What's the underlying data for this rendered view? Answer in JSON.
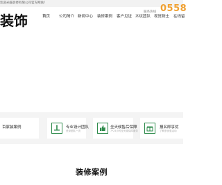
{
  "topbar": {
    "welcome": "欢迎光临装修有限公司官方网站！"
  },
  "header": {
    "logo": "装饰",
    "hotline_label": "服务热线",
    "phone": "0558"
  },
  "nav": {
    "items": [
      "首页",
      "公司简介",
      "新闻中心",
      "装修案例",
      "客户见证",
      "木纹团队",
      "视觉物土",
      "在线留"
    ]
  },
  "features": [
    {
      "title": "百家装案例",
      "sub": "",
      "icon": "gallery-icon"
    },
    {
      "title": "专业设计团队",
      "sub": "资深团队一流",
      "icon": "designer-icon"
    },
    {
      "title": "全天候售后保障",
      "sub": "7*24小时全天候保障服务",
      "icon": "thumbs-up-icon"
    },
    {
      "title": "报名即享优",
      "sub": "了解多优惠活动",
      "icon": "gift-icon"
    }
  ],
  "section": {
    "title": "装修案例"
  },
  "colors": {
    "accent": "#f0a030",
    "feature_icon": "#2e8b4b"
  }
}
